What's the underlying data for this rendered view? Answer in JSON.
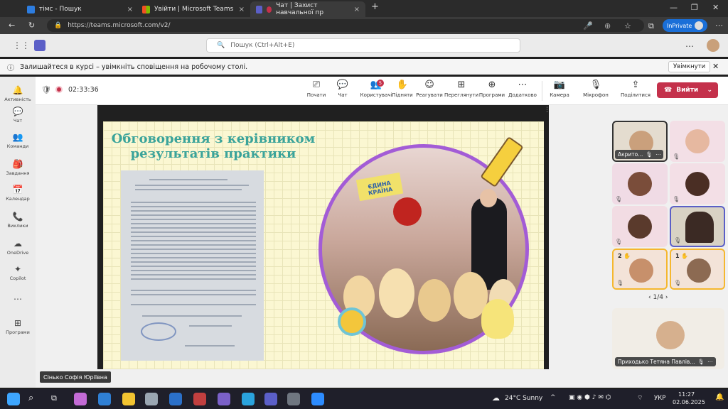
{
  "browser": {
    "tabs": [
      {
        "title": "тімс - Пошук",
        "close": "×"
      },
      {
        "title": "Увійти | Microsoft Teams",
        "close": "×"
      },
      {
        "title": "Чат | Захист навчальної пр",
        "close": "×"
      }
    ],
    "new_tab": "+",
    "url": "https://teams.microsoft.com/v2/",
    "inprivate": "InPrivate"
  },
  "teams": {
    "search_placeholder": "Пошук (Ctrl+Alt+E)",
    "notification": "Залишайтеся в курсі – увімкніть сповіщення на робочому столі.",
    "notification_button": "Увімкнути",
    "rail": [
      "Активність",
      "Чат",
      "Команди",
      "Завдання",
      "Календар",
      "Виклики",
      "OneDrive",
      "Copilot",
      "Програми"
    ],
    "timer": "02:33:36",
    "toolbar": [
      "Почати",
      "Чат",
      "Користувачі",
      "Підняти",
      "Реагувати",
      "Переглянути",
      "Програми",
      "Додатково",
      "Камера",
      "Мікрофон",
      "Поділитися"
    ],
    "people_badge": "5",
    "leave": "Вийти"
  },
  "slide": {
    "title_line1": "Обговорення з керівником",
    "title_line2": "результатів практики",
    "banner": "ЄДИНА КРАЇНА"
  },
  "participants": {
    "tile1_name": "Акрито...",
    "raise1": "2",
    "raise2": "1",
    "pager": "1/4",
    "big_name": "Приходько Тетяна Павлів..."
  },
  "presenter": "Сінько Софія Юріївна",
  "taskbar": {
    "weather": "24°C  Sunny",
    "lang": "УКР",
    "time": "11:27",
    "date": "02.06.2025"
  },
  "colors": {
    "teams_purple": "#5b5fc7",
    "leave_red": "#c4314b",
    "slide_teal": "#3aa39a",
    "photo_border": "#a35cd6",
    "raised_hand": "#f5b72e"
  }
}
